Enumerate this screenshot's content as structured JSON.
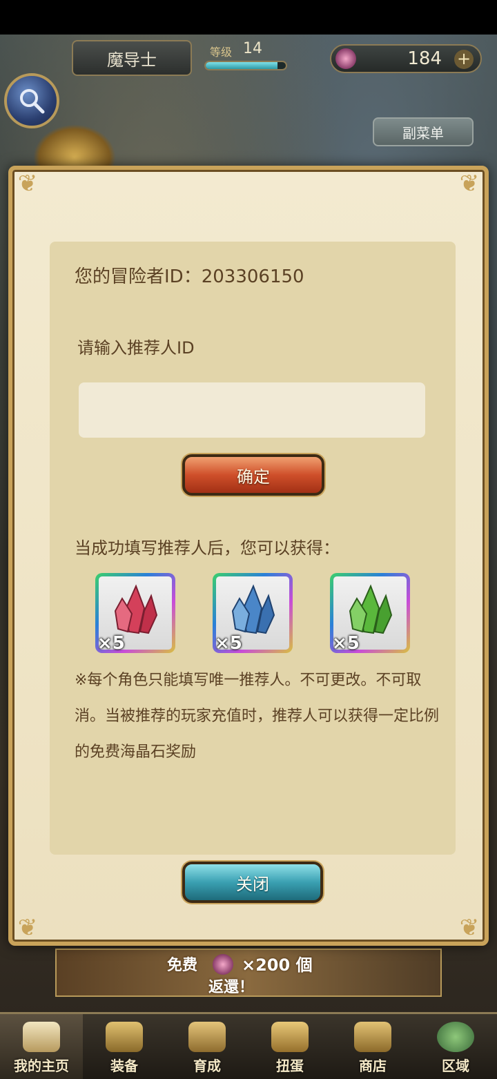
{
  "header": {
    "player_name": "魔导士",
    "level_label": "等级",
    "level_value": "14",
    "level_progress": 0.9,
    "gem_count": "184",
    "plus_symbol": "+",
    "submenu_label": "副菜单"
  },
  "dialog": {
    "adventurer_id_line": "您的冒险者ID：203306150",
    "input_prompt": "请输入推荐人ID",
    "input_value": "",
    "input_placeholder": "",
    "confirm_label": "确定",
    "reward_title": "当成功填写推荐人后，您可以获得：",
    "rewards": [
      {
        "icon": "red-crystal-icon",
        "color": "#d4405a",
        "quantity": "×5"
      },
      {
        "icon": "blue-crystal-icon",
        "color": "#4a86c8",
        "quantity": "×5"
      },
      {
        "icon": "green-crystal-icon",
        "color": "#5ab83c",
        "quantity": "×5"
      }
    ],
    "note": "※每个角色只能填写唯一推荐人。不可更改。不可取消。当被推荐的玩家充值时，推荐人可以获得一定比例的免费海晶石奖励",
    "close_label": "关闭"
  },
  "banner": {
    "free_text": "免费",
    "amount_text": "×200 個",
    "return_text": "返還！"
  },
  "bottom_nav": [
    {
      "label": "我的主页",
      "icon": "home-scroll-icon",
      "active": true
    },
    {
      "label": "装备",
      "icon": "helmet-icon",
      "active": false
    },
    {
      "label": "育成",
      "icon": "sword-icon",
      "active": false
    },
    {
      "label": "扭蛋",
      "icon": "gacha-bell-icon",
      "active": false
    },
    {
      "label": "商店",
      "icon": "shop-bag-icon",
      "active": false
    },
    {
      "label": "区域",
      "icon": "globe-icon",
      "active": false
    }
  ],
  "colors": {
    "dialog_bg": "#f3ead0",
    "panel_bg": "#e2d5aa",
    "text_brown": "#5b4124",
    "confirm_red": "#cf4f2a",
    "close_teal": "#3aa0b2"
  }
}
